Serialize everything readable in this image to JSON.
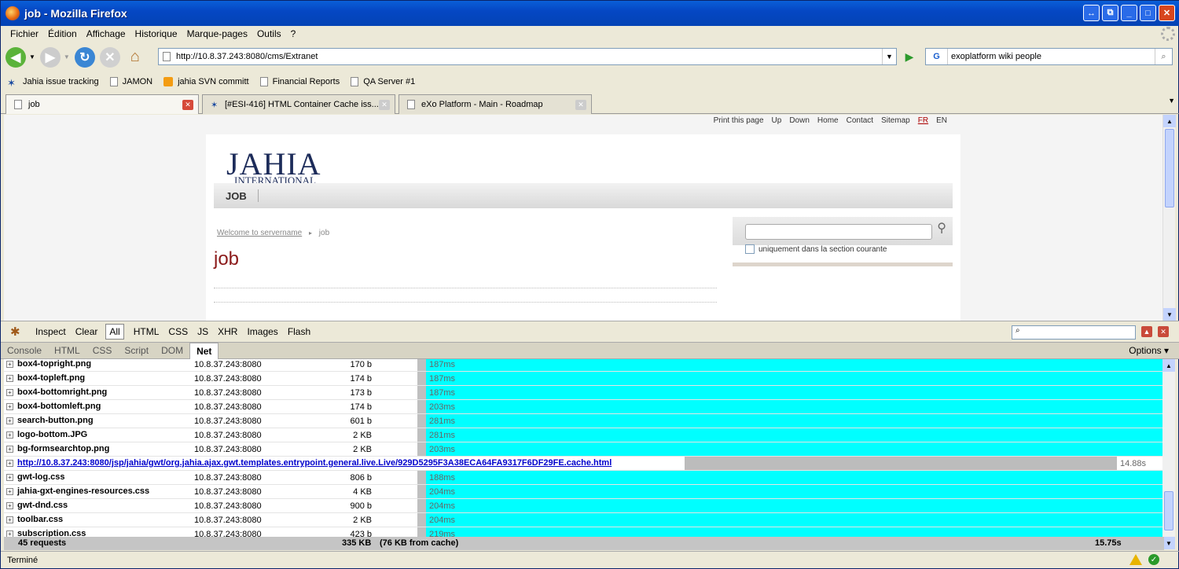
{
  "window": {
    "title": "job - Mozilla Firefox"
  },
  "menu": [
    "Fichier",
    "Édition",
    "Affichage",
    "Historique",
    "Marque-pages",
    "Outils",
    "?"
  ],
  "nav": {
    "url": "http://10.8.37.243:8080/cms/Extranet",
    "search_value": "exoplatform wiki people",
    "search_engine": "G"
  },
  "bookmarks": [
    {
      "label": "Jahia issue tracking",
      "icon": "jahia-icon"
    },
    {
      "label": "JAMON",
      "icon": "page-icon"
    },
    {
      "label": "jahia SVN committ",
      "icon": "rss-icon"
    },
    {
      "label": "Financial Reports",
      "icon": "page-icon"
    },
    {
      "label": "QA Server #1",
      "icon": "page-icon"
    }
  ],
  "tabs": [
    {
      "label": "job"
    },
    {
      "label": "[#ESI-416] HTML Container Cache iss..."
    },
    {
      "label": "eXo Platform - Main - Roadmap"
    }
  ],
  "page": {
    "toplinks": [
      "Print this page",
      "Up",
      "Down",
      "Home",
      "Contact",
      "Sitemap",
      "FR",
      "EN"
    ],
    "logo_main": "JAHIA",
    "logo_sub": "INTERNATIONAL",
    "nav_item": "JOB",
    "breadcrumb_home": "Welcome to servername",
    "breadcrumb_current": "job",
    "title": "job",
    "search_checkbox_label": "uniquement dans la section courante"
  },
  "firebug": {
    "toolbar": [
      "Inspect",
      "Clear",
      "All",
      "HTML",
      "CSS",
      "JS",
      "XHR",
      "Images",
      "Flash"
    ],
    "tabs": [
      "Console",
      "HTML",
      "CSS",
      "Script",
      "DOM",
      "Net"
    ],
    "active_tab": "Net",
    "options": "Options ▾"
  },
  "net_rows": [
    {
      "name": "box4-topright.png",
      "host": "10.8.37.243:8080",
      "size": "170 b",
      "time": "187ms"
    },
    {
      "name": "box4-topleft.png",
      "host": "10.8.37.243:8080",
      "size": "174 b",
      "time": "187ms"
    },
    {
      "name": "box4-bottomright.png",
      "host": "10.8.37.243:8080",
      "size": "173 b",
      "time": "187ms"
    },
    {
      "name": "box4-bottomleft.png",
      "host": "10.8.37.243:8080",
      "size": "174 b",
      "time": "203ms"
    },
    {
      "name": "search-button.png",
      "host": "10.8.37.243:8080",
      "size": "601 b",
      "time": "281ms"
    },
    {
      "name": "logo-bottom.JPG",
      "host": "10.8.37.243:8080",
      "size": "2 KB",
      "time": "281ms"
    },
    {
      "name": "bg-formsearchtop.png",
      "host": "10.8.37.243:8080",
      "size": "2 KB",
      "time": "203ms"
    },
    {
      "name": "http://10.8.37.243:8080/jsp/jahia/gwt/org.jahia.ajax.gwt.templates.entrypoint.general.live.Live/929D5295F3A38ECA64FA9317F6DF29FE.cache.html",
      "host": "",
      "size": "",
      "time": "14.88s",
      "link": true
    },
    {
      "name": "gwt-log.css",
      "host": "10.8.37.243:8080",
      "size": "806 b",
      "time": "188ms"
    },
    {
      "name": "jahia-gxt-engines-resources.css",
      "host": "10.8.37.243:8080",
      "size": "4 KB",
      "time": "204ms"
    },
    {
      "name": "gwt-dnd.css",
      "host": "10.8.37.243:8080",
      "size": "900 b",
      "time": "204ms"
    },
    {
      "name": "toolbar.css",
      "host": "10.8.37.243:8080",
      "size": "2 KB",
      "time": "204ms"
    },
    {
      "name": "subscription.css",
      "host": "10.8.37.243:8080",
      "size": "423 b",
      "time": "219ms"
    }
  ],
  "summary": {
    "requests": "45 requests",
    "size": "335 KB",
    "cache": "(76 KB from cache)",
    "total": "15.75s"
  },
  "status": {
    "text": "Terminé"
  }
}
